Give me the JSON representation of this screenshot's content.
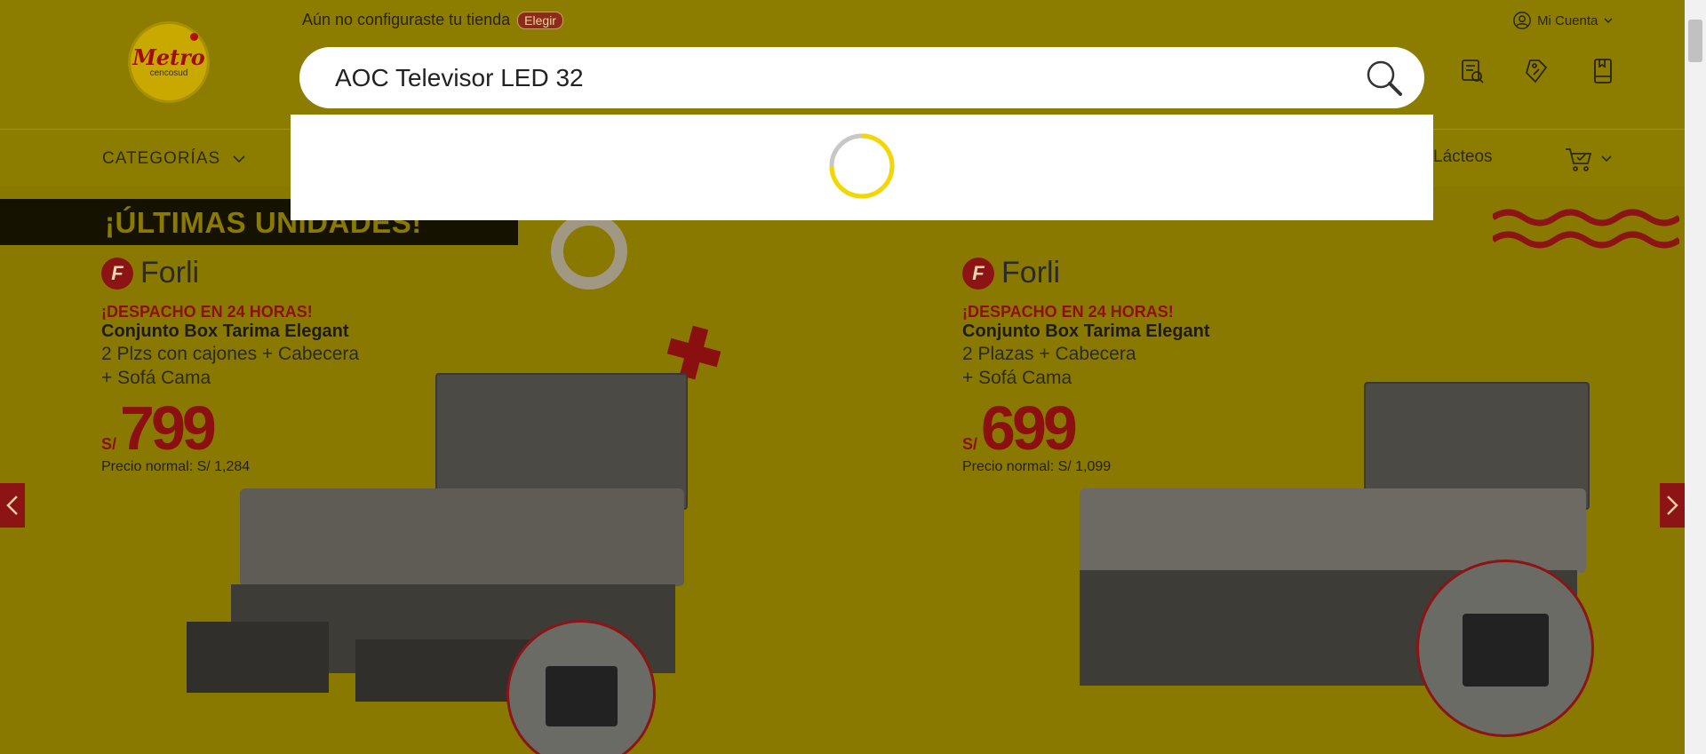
{
  "header": {
    "logo": {
      "brand": "Metro",
      "sub": "cencosud"
    },
    "store_message": "Aún no configuraste tu tienda",
    "choose_store": "Elegir",
    "account": "Mi Cuenta",
    "search": {
      "value": "AOC Televisor LED 32",
      "placeholder": ""
    },
    "icons": [
      "order-tracking-icon",
      "coupons-icon",
      "shopping-list-icon"
    ]
  },
  "nav": {
    "categories": "CATEGORÍAS",
    "visible_item": "Lácteos"
  },
  "dropdown": {
    "state": "loading"
  },
  "banner": {
    "ribbon": "¡ÚLTIMAS UNIDADES!",
    "promos": [
      {
        "brand": "Forli",
        "shipping": "¡DESPACHO EN 24 HORAS!",
        "title": "Conjunto Box Tarima Elegant",
        "line1": "2 Plzs con cajones + Cabecera",
        "line2": "+ Sofá Cama",
        "currency": "S/",
        "price": "799",
        "normal_price": "Precio normal: S/ 1,284"
      },
      {
        "brand": "Forli",
        "shipping": "¡DESPACHO EN 24 HORAS!",
        "title": "Conjunto Box Tarima Elegant",
        "line1": "2 Plazas + Cabecera",
        "line2": "+ Sofá Cama",
        "currency": "S/",
        "price": "699",
        "normal_price": "Precio normal: S/ 1,099"
      }
    ]
  },
  "colors": {
    "overlay_yellow": "#8c7d00",
    "accent_red": "#8c1414",
    "spinner": "#f2d800"
  }
}
